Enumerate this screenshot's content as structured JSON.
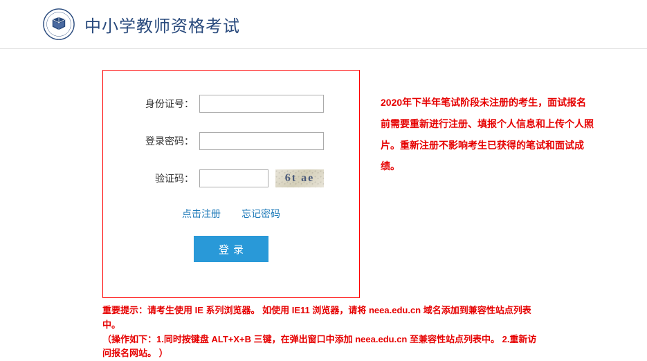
{
  "header": {
    "title": "中小学教师资格考试"
  },
  "form": {
    "id_label": "身份证号：",
    "id_value": "",
    "password_label": "登录密码：",
    "password_value": "",
    "captcha_label": "验证码：",
    "captcha_value": "",
    "captcha_image_text": "6t ae"
  },
  "links": {
    "register": "点击注册",
    "forgot": "忘记密码"
  },
  "buttons": {
    "login": "登录"
  },
  "side_notice": "2020年下半年笔试阶段未注册的考生，面试报名前需要重新进行注册、填报个人信息和上传个人照片。重新注册不影响考生已获得的笔试和面试成绩。",
  "footer_line1": "重要提示：请考生使用 IE 系列浏览器。 如使用 IE11 浏览器，请将 neea.edu.cn 域名添加到兼容性站点列表中。",
  "footer_line2": "（操作如下：1.同时按键盘 ALT+X+B 三键，在弹出窗口中添加 neea.edu.cn 至兼容性站点列表中。 2.重新访问报名网站。 ）"
}
